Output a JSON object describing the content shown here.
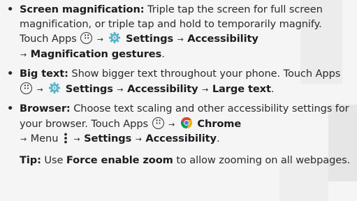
{
  "items": [
    {
      "title": "Screen magnification:",
      "text_1": "Triple tap the screen for full screen magnification, or triple tap and hold to temporarily magnify. Touch Apps",
      "path": [
        "Settings",
        "Accessibility",
        "Magnification gestures"
      ],
      "end": "."
    },
    {
      "title": "Big text:",
      "text_1": "Show bigger text throughout your phone. Touch Apps",
      "path": [
        "Settings",
        "Accessibility",
        "Large text"
      ],
      "end": "."
    },
    {
      "title": "Browser:",
      "text_1": "Choose text scaling and other accessibility settings for your browser. Touch Apps",
      "chrome": "Chrome",
      "menu": "Menu",
      "path": [
        "Settings",
        "Accessibility"
      ],
      "end": "."
    }
  ],
  "tip": {
    "label": "Tip:",
    "text_1": "Use",
    "bold": "Force enable zoom",
    "text_2": "to allow zooming on all webpages."
  },
  "symbols": {
    "bullet": "•",
    "arrow": "→"
  },
  "colors": {
    "text": "#2b2b2b",
    "settings_gear": "#5bb3c9",
    "chrome_red": "#db4437",
    "chrome_yellow": "#f4b400",
    "chrome_green": "#0f9d58",
    "chrome_blue": "#4285f4"
  },
  "icons": [
    "apps-icon",
    "settings-gear-icon",
    "chrome-icon",
    "menu-dots-icon"
  ]
}
